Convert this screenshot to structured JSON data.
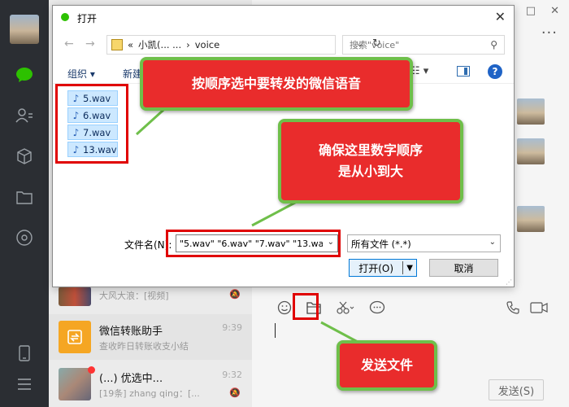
{
  "colors": {
    "callout_fill": "#e92c2c",
    "callout_border": "#6fbf4a",
    "highlight": "#e00000",
    "wechat_green": "#2dc100"
  },
  "wechat": {
    "window_controls": [
      "□",
      "✕"
    ],
    "more": "···",
    "sidebar_icons": [
      "chat-icon",
      "contacts-icon",
      "cube-icon",
      "folder-icon",
      "moments-icon",
      "phone-icon",
      "menu-icon"
    ],
    "chat_list": [
      {
        "title": "",
        "subtitle": "大风大浪：[视频]",
        "time": "",
        "muted": true
      },
      {
        "title": "微信转账助手",
        "subtitle": "查收昨日转账收支小结",
        "time": "9:39",
        "muted": false
      },
      {
        "title": "(...) 优选中...",
        "subtitle": "[19条] zhang  qing：[...",
        "time": "9:32",
        "muted": true
      }
    ],
    "toolbar_icons": [
      "emoji-icon",
      "folder-icon",
      "scissors-icon",
      "chat-bubble-icon",
      "phone-icon",
      "video-icon"
    ],
    "send_button": "发送(S)"
  },
  "dialog": {
    "title": "打开",
    "close": "✕",
    "nav_back": "←",
    "nav_forward": "→",
    "address_segments": [
      "«",
      "小凯(... ...",
      "›",
      "voice"
    ],
    "search_placeholder": "搜索\"voice\"",
    "organize": "组织 ▾",
    "new_folder": "新建",
    "view_button": "☷ ▾",
    "help": "?",
    "files": [
      "5.wav",
      "6.wav",
      "7.wav",
      "13.wav"
    ],
    "filename_label": "文件名(N):",
    "filename_value": "\"5.wav\" \"6.wav\" \"7.wav\" \"13.wa",
    "filetype_value": "所有文件 (*.*)",
    "open_button": "打开(O)",
    "cancel_button": "取消"
  },
  "callouts": {
    "select_voice": "按顺序选中要转发的微信语音",
    "order_line1": "确保这里数字顺序",
    "order_line2": "是从小到大",
    "send_file": "发送文件"
  }
}
